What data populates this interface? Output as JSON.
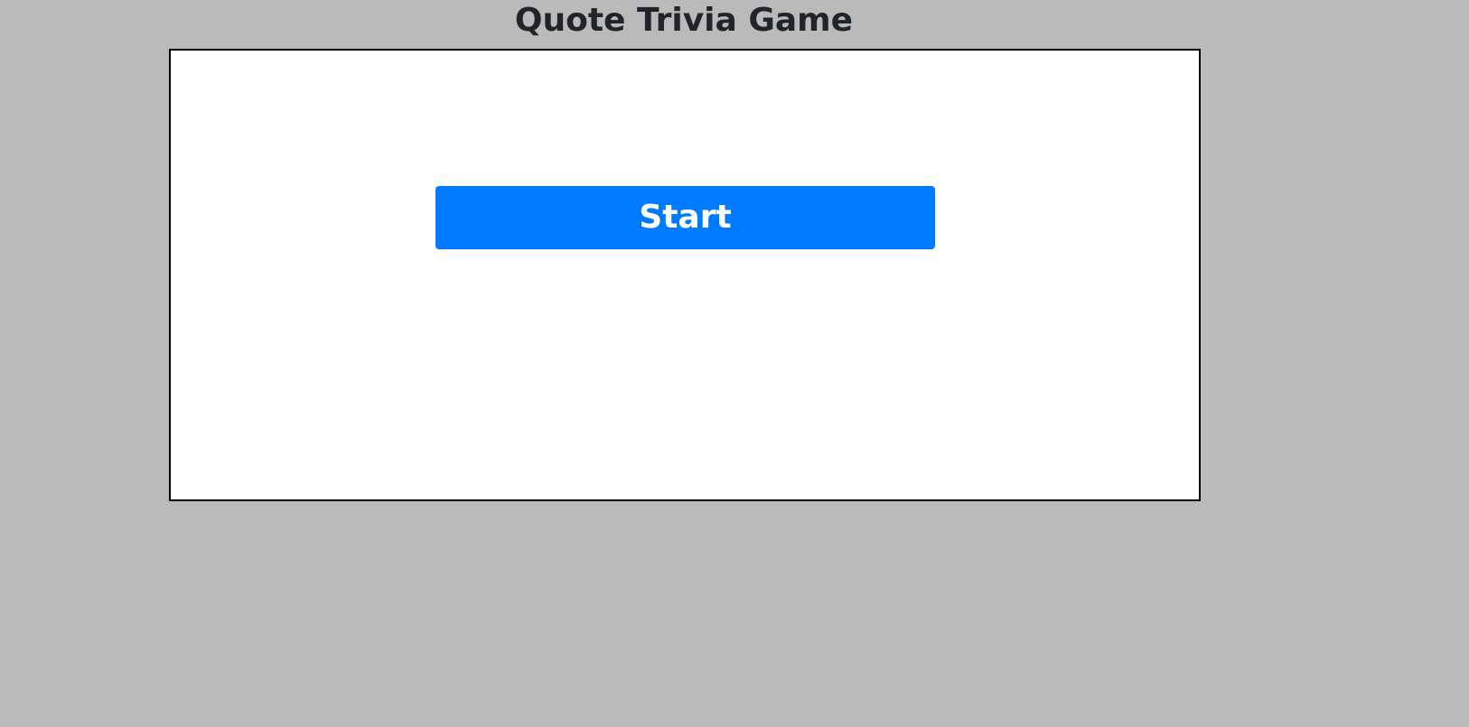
{
  "page": {
    "title": "Quote Trivia Game",
    "background_color": "#bababa"
  },
  "game": {
    "start_label": "Start",
    "button_color": "#007bff"
  }
}
